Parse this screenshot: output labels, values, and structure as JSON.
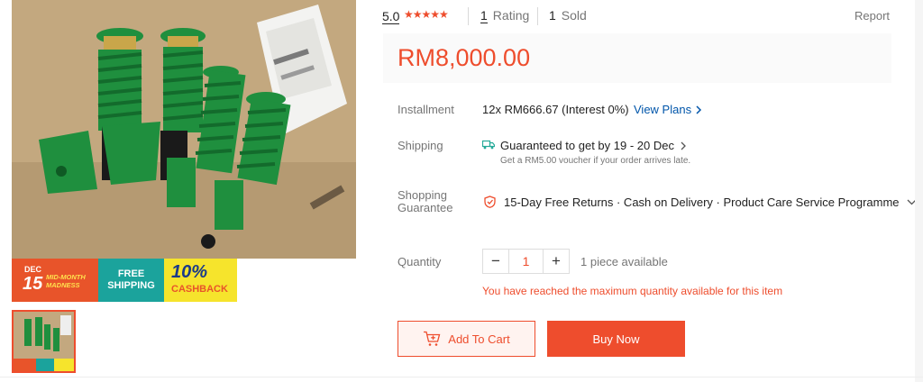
{
  "banner": {
    "dec": "DEC",
    "day": "15",
    "madness": "MID-MONTH MADNESS",
    "free_line1": "FREE",
    "free_line2": "SHIPPING",
    "cash_pct": "10%",
    "cash_label": "CASHBACK"
  },
  "rating": {
    "score": "5.0",
    "stars": 5,
    "ratings_count": "1",
    "ratings_label": "Rating",
    "sold_count": "1",
    "sold_label": "Sold",
    "report": "Report"
  },
  "price": "RM8,000.00",
  "installment": {
    "label": "Installment",
    "value": "12x RM666.67 (Interest 0%)",
    "link": "View Plans"
  },
  "shipping": {
    "label": "Shipping",
    "value": "Guaranteed to get by 19 - 20 Dec",
    "note": "Get a RM5.00 voucher if your order arrives late."
  },
  "guarantee": {
    "label_line1": "Shopping",
    "label_line2": "Guarantee",
    "value": "15-Day Free Returns · Cash on Delivery · Product Care Service Programme"
  },
  "quantity": {
    "label": "Quantity",
    "minus": "−",
    "value": "1",
    "plus": "+",
    "available": "1 piece available",
    "warning": "You have reached the maximum quantity available for this item"
  },
  "actions": {
    "add_to_cart": "Add To Cart",
    "buy_now": "Buy Now"
  },
  "colors": {
    "accent": "#ee4d2d",
    "link": "#0055aa",
    "coilover_green": "#1f8f3e"
  }
}
